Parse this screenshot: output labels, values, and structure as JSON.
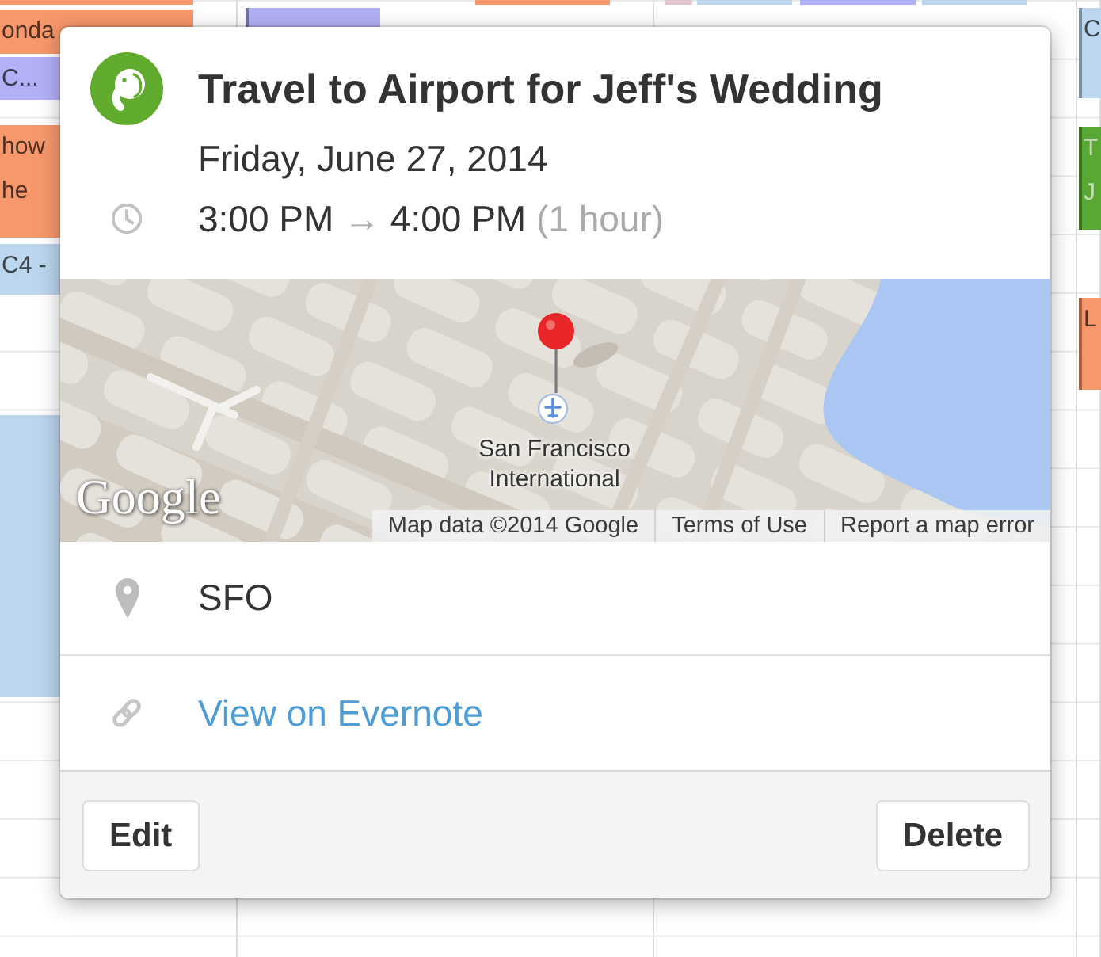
{
  "calendar": {
    "columns": [
      {
        "events": [
          {
            "color": "#f7986c"
          },
          {
            "color": "#f7986c",
            "lines": [
              "onda"
            ]
          },
          {
            "color": "#b3b1f5",
            "lines": [
              "C..."
            ]
          },
          {
            "color": "#f7986c",
            "lines": [
              "how",
              "he"
            ]
          },
          {
            "color": "#bcd6ef",
            "lines": [
              "C4 -"
            ]
          },
          {
            "color": "#bcd6ef"
          }
        ]
      },
      {
        "events": [
          {
            "color": "#f7986c"
          },
          {
            "color": "#b3b1f5"
          }
        ]
      },
      {
        "events": [
          {
            "color": "#e2c2cf"
          },
          {
            "color": "#bcd6ef"
          },
          {
            "color": "#b3b1f5"
          },
          {
            "color": "#bcd6ef"
          }
        ]
      },
      {
        "events": [
          {
            "color": "#bcd6ef",
            "lines": [
              "C"
            ]
          },
          {
            "color": "#5aa834",
            "lines": [
              "T",
              "J"
            ]
          },
          {
            "color": "#f7986c",
            "lines": [
              "L"
            ]
          }
        ]
      }
    ]
  },
  "popover": {
    "title": "Travel to Airport for Jeff's Wedding",
    "date": "Friday, June 27, 2014",
    "time": {
      "start": "3:00 PM",
      "arrow": "→",
      "end": "4:00 PM",
      "duration": "(1 hour)"
    },
    "map": {
      "place_label": "San Francisco International",
      "logo": "Google",
      "attribution": [
        "Map data ©2014 Google",
        "Terms of Use",
        "Report a map error"
      ]
    },
    "location": "SFO",
    "link": "View on Evernote",
    "buttons": [
      "Edit",
      "Delete"
    ]
  }
}
